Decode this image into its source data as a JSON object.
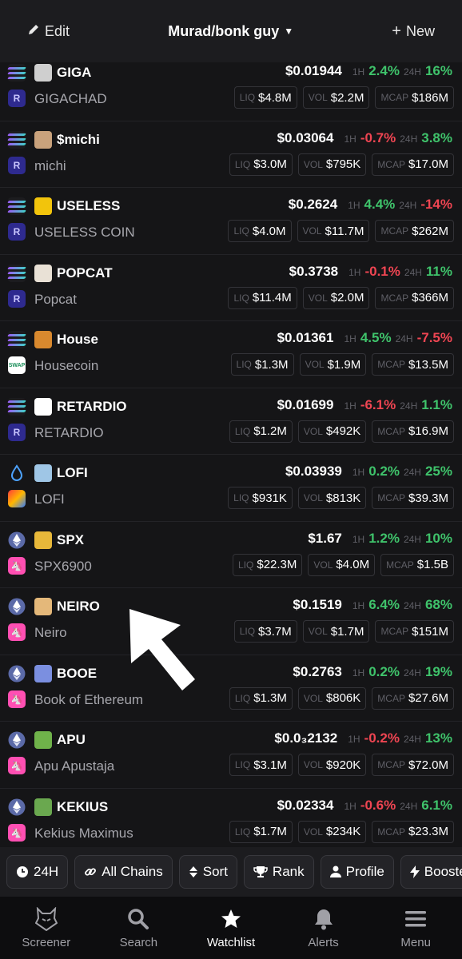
{
  "header": {
    "edit_label": "Edit",
    "title": "Murad/bonk guy",
    "new_label": "New"
  },
  "labels": {
    "h1": "1H",
    "h24": "24H",
    "liq": "LIQ",
    "vol": "VOL",
    "mcap": "MCAP"
  },
  "rows": [
    {
      "symbol": "GIGA",
      "name": "GIGACHAD",
      "chain": "sol-icon",
      "dex": "raydium-icon",
      "price": "$0.01944",
      "h1": "2.4%",
      "h1_dir": "pos",
      "h24": "16%",
      "h24_dir": "pos",
      "liq": "$4.8M",
      "vol": "$2.2M",
      "mcap": "$186M",
      "icon_color": "#cfcfcf"
    },
    {
      "symbol": "$michi",
      "name": "michi",
      "chain": "sol-icon",
      "dex": "raydium-icon",
      "price": "$0.03064",
      "h1": "-0.7%",
      "h1_dir": "neg",
      "h24": "3.8%",
      "h24_dir": "pos",
      "liq": "$3.0M",
      "vol": "$795K",
      "mcap": "$17.0M",
      "icon_color": "#c9a27c"
    },
    {
      "symbol": "USELESS",
      "name": "USELESS COIN",
      "chain": "sol-icon",
      "dex": "raydium-icon",
      "price": "$0.2624",
      "h1": "4.4%",
      "h1_dir": "pos",
      "h24": "-14%",
      "h24_dir": "neg",
      "liq": "$4.0M",
      "vol": "$11.7M",
      "mcap": "$262M",
      "icon_color": "#f2c40c"
    },
    {
      "symbol": "POPCAT",
      "name": "Popcat",
      "chain": "sol-icon",
      "dex": "raydium-icon",
      "price": "$0.3738",
      "h1": "-0.1%",
      "h1_dir": "neg",
      "h24": "11%",
      "h24_dir": "pos",
      "liq": "$11.4M",
      "vol": "$2.0M",
      "mcap": "$366M",
      "icon_color": "#e9e1d6"
    },
    {
      "symbol": "House",
      "name": "Housecoin",
      "chain": "sol-icon",
      "dex": "swap-icon",
      "price": "$0.01361",
      "h1": "4.5%",
      "h1_dir": "pos",
      "h24": "-7.5%",
      "h24_dir": "neg",
      "liq": "$1.3M",
      "vol": "$1.9M",
      "mcap": "$13.5M",
      "icon_color": "#d9892e"
    },
    {
      "symbol": "RETARDIO",
      "name": "RETARDIO",
      "chain": "sol-icon",
      "dex": "raydium-icon",
      "price": "$0.01699",
      "h1": "-6.1%",
      "h1_dir": "neg",
      "h24": "1.1%",
      "h24_dir": "pos",
      "liq": "$1.2M",
      "vol": "$492K",
      "mcap": "$16.9M",
      "icon_color": "#ffffff"
    },
    {
      "symbol": "LOFI",
      "name": "LOFI",
      "chain": "sui-icon",
      "dex": "multicolor-dex-icon",
      "price": "$0.03939",
      "h1": "0.2%",
      "h1_dir": "pos",
      "h24": "25%",
      "h24_dir": "pos",
      "liq": "$931K",
      "vol": "$813K",
      "mcap": "$39.3M",
      "icon_color": "#9fc6e6"
    },
    {
      "symbol": "SPX",
      "name": "SPX6900",
      "chain": "eth-icon",
      "dex": "uniswap-icon",
      "price": "$1.67",
      "h1": "1.2%",
      "h1_dir": "pos",
      "h24": "10%",
      "h24_dir": "pos",
      "liq": "$22.3M",
      "vol": "$4.0M",
      "mcap": "$1.5B",
      "icon_color": "#e8b83a"
    },
    {
      "symbol": "NEIRO",
      "name": "Neiro",
      "chain": "eth-icon",
      "dex": "uniswap-icon",
      "price": "$0.1519",
      "h1": "6.4%",
      "h1_dir": "pos",
      "h24": "68%",
      "h24_dir": "pos",
      "liq": "$3.7M",
      "vol": "$1.7M",
      "mcap": "$151M",
      "icon_color": "#e4b87a"
    },
    {
      "symbol": "BOOE",
      "name": "Book of Ethereum",
      "chain": "eth-icon",
      "dex": "uniswap-icon",
      "price": "$0.2763",
      "h1": "0.2%",
      "h1_dir": "pos",
      "h24": "19%",
      "h24_dir": "pos",
      "liq": "$1.3M",
      "vol": "$806K",
      "mcap": "$27.6M",
      "icon_color": "#7b8fe0"
    },
    {
      "symbol": "APU",
      "name": "Apu Apustaja",
      "chain": "eth-icon",
      "dex": "uniswap-icon",
      "price": "$0.0₃2132",
      "h1": "-0.2%",
      "h1_dir": "neg",
      "h24": "13%",
      "h24_dir": "pos",
      "liq": "$3.1M",
      "vol": "$920K",
      "mcap": "$72.0M",
      "icon_color": "#6fb24a"
    },
    {
      "symbol": "KEKIUS",
      "name": "Kekius Maximus",
      "chain": "eth-icon",
      "dex": "uniswap-icon",
      "price": "$0.02334",
      "h1": "-0.6%",
      "h1_dir": "neg",
      "h24": "6.1%",
      "h24_dir": "pos",
      "liq": "$1.7M",
      "vol": "$234K",
      "mcap": "$23.3M",
      "icon_color": "#6aa84f"
    }
  ],
  "filters": [
    {
      "label": "24H",
      "icon": "clock-icon"
    },
    {
      "label": "All Chains",
      "icon": "link-icon"
    },
    {
      "label": "Sort",
      "icon": "sort-icon"
    },
    {
      "label": "Rank",
      "icon": "trophy-icon"
    },
    {
      "label": "Profile",
      "icon": "person-icon"
    },
    {
      "label": "Boosted",
      "icon": "bolt-icon"
    }
  ],
  "nav": [
    {
      "label": "Screener",
      "icon": "screener-logo-icon",
      "active": false
    },
    {
      "label": "Search",
      "icon": "search-icon",
      "active": false
    },
    {
      "label": "Watchlist",
      "icon": "star-icon",
      "active": true
    },
    {
      "label": "Alerts",
      "icon": "bell-icon",
      "active": false
    },
    {
      "label": "Menu",
      "icon": "menu-icon",
      "active": false
    }
  ],
  "colors": {
    "positive": "#3fc36b",
    "negative": "#ef4552",
    "raydium": "#3b36c9",
    "uniswap": "#ff4fb2"
  }
}
